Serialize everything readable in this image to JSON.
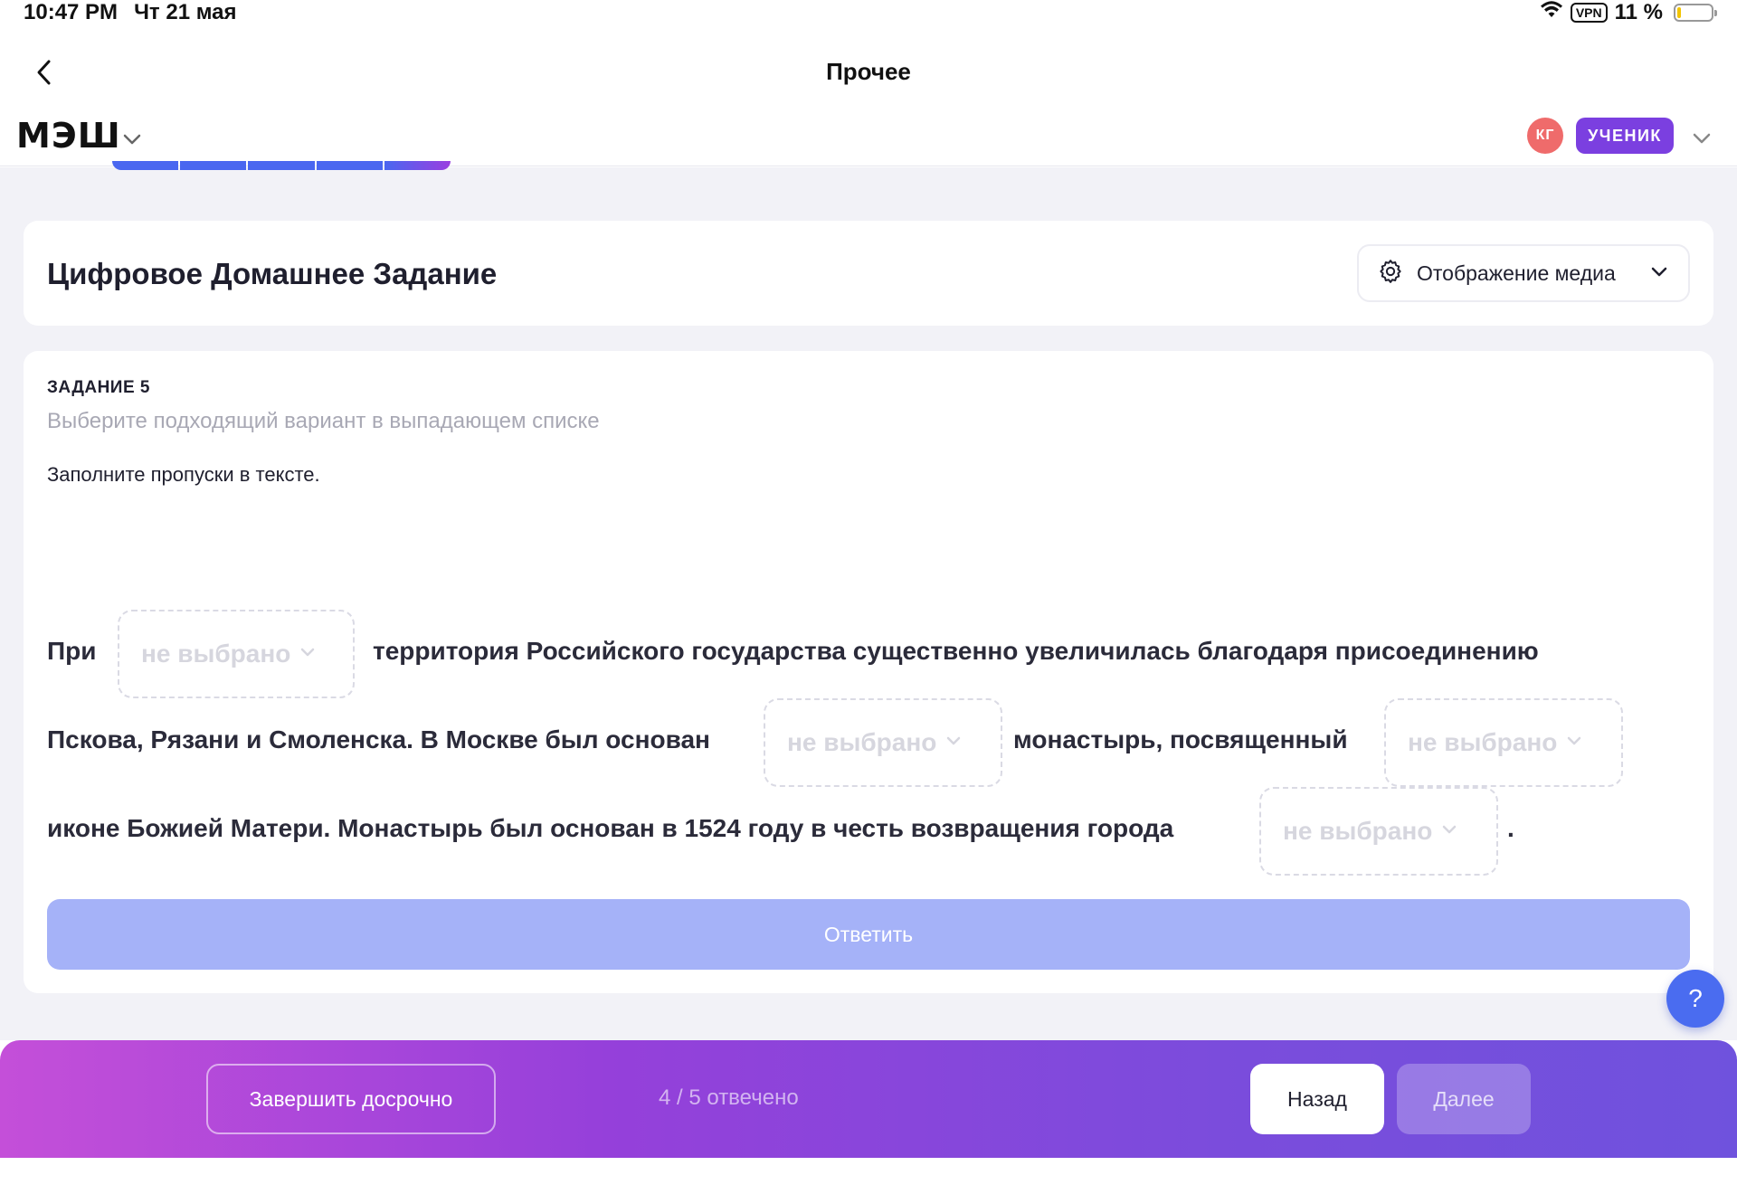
{
  "status_bar": {
    "time": "10:47 PM",
    "date": "Чт 21 мая",
    "vpn": "VPN",
    "battery": "11 %",
    "battery_level": 0.11
  },
  "nav": {
    "title": "Прочее"
  },
  "app_header": {
    "logo": "МЭШ",
    "avatar_initials": "КГ",
    "role": "УЧЕНИК"
  },
  "homework": {
    "title": "Цифровое Домашнее Задание",
    "media_button": "Отображение медиа"
  },
  "task": {
    "number_label": "ЗАДАНИЕ 5",
    "hint": "Выберите подходящий вариант в выпадающем списке",
    "instruction": "Заполните пропуски в тексте.",
    "segments": {
      "s1": "При",
      "s2": "территория Российского государства существенно увеличилась благодаря присоединению",
      "s3": "Пскова, Рязани и Смоленска. В Москве был основан",
      "s4": "монастырь, посвященный",
      "s5": "иконе Божией Матери. Монастырь был основан в 1524 году в честь возвращения города",
      "s6": "."
    },
    "dropdowns": [
      {
        "value": "не выбрано"
      },
      {
        "value": "не выбрано"
      },
      {
        "value": "не выбрано"
      },
      {
        "value": "не выбрано"
      }
    ],
    "answer_button": "Ответить"
  },
  "help": {
    "label": "?"
  },
  "bottom_bar": {
    "finish_button": "Завершить досрочно",
    "progress_text": "4 / 5 отвечено",
    "back_button": "Назад",
    "next_button": "Далее"
  },
  "colors": {
    "accent": "#7b3fe0",
    "answer_disabled": "#a5b2f8",
    "avatar": "#ef6b6b",
    "help": "#4a6cf0"
  }
}
